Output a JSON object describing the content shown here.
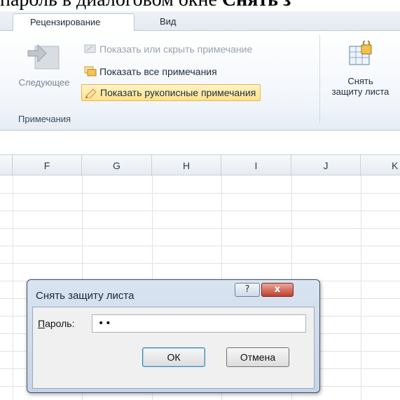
{
  "doc_text": {
    "prefix": "пароль в диалоговом окне ",
    "bold": "Снять з"
  },
  "ribbon": {
    "tabs": [
      {
        "label": "Рецензирование"
      },
      {
        "label": "Вид"
      }
    ],
    "comments_group": {
      "next_label": "Следующее",
      "show_hide_comment": "Показать или скрыть примечание",
      "show_all_comments": "Показать все примечания",
      "show_ink_comments": "Показать рукописные примечания",
      "group_label": "Примечания"
    },
    "unprotect": {
      "line1": "Снять",
      "line2": "защиту листа"
    }
  },
  "sheet": {
    "columns": [
      "F",
      "G",
      "H",
      "I",
      "J",
      "K"
    ]
  },
  "dialog": {
    "title": "Снять защиту листа",
    "help_label": "?",
    "close_label": "x",
    "password_label_underlined": "П",
    "password_label_rest": "ароль:",
    "password_value": "••",
    "ok_label": "ОК",
    "cancel_label": "Отмена"
  },
  "colors": {
    "ribbon_highlight": "#ffe28a",
    "dialog_frame": "#c5d4e7",
    "close_button": "#c0402d"
  }
}
